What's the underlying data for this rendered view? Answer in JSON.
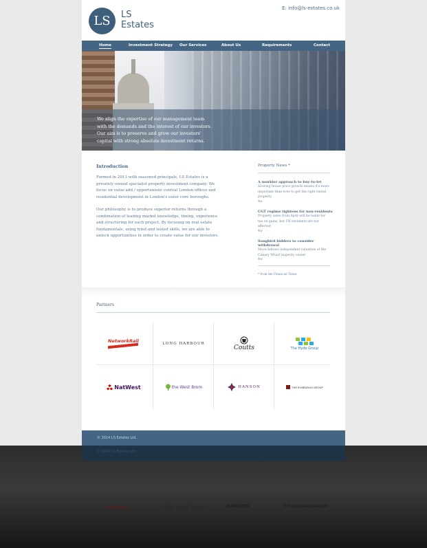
{
  "header": {
    "logo_mark": "LS",
    "logo_line1": "LS",
    "logo_line2": "Estates",
    "email": "E: info@ls-estates.co.uk"
  },
  "nav": {
    "items": [
      "Home",
      "Investment Strategy",
      "Our Services",
      "About Us",
      "Requirements",
      "Contact"
    ],
    "active": "Home"
  },
  "hero": {
    "lines": [
      "We align the expertise of our management team",
      "with the demands and the interest of our investors.",
      "Our aim is to preserve and grow our investors'",
      "capital with strong absolute investment returns."
    ]
  },
  "intro": {
    "title": "Introduction",
    "para1": [
      "Formed in 2013 with seasoned principals, LS Estates is a",
      "privately owned specialist property investment company. We",
      "focus on value add / opportunistic central London offices and",
      "residential development in London's outer core boroughs."
    ],
    "para2": [
      "Our philosophy is to produce superior returns through a",
      "combination of leading market knowledge, timing, experience",
      "and structuring for each project. By focusing on real estate",
      "fundamentals, using tried and tested skills, we are able to",
      "unlock opportunities in order to create value for our investors."
    ]
  },
  "news": {
    "title": "Property News *",
    "items": [
      {
        "title": "A murkier approach to buy-to-let",
        "text": [
          "Slowing house price growth means it's more",
          "important than ever to get the right rental",
          "property"
        ],
        "more": "4w"
      },
      {
        "title": "CGT regime tightens for non-residents",
        "text": [
          "Property sales from April will be liable for",
          "tax on gains, but UK residents are not",
          "affected"
        ],
        "more": "4w"
      },
      {
        "title": "Songbird bidders to consider withdrawal",
        "text": [
          "Move follows independent valuation of the",
          "Canary Wharf majority owner"
        ],
        "more": "4w"
      }
    ],
    "source": "* from the Financial Times"
  },
  "partners": {
    "title": "Partners",
    "logos": [
      "NetworkRail",
      "LONG HARBOUR",
      "Coutts",
      "The Hyde Group",
      "NatWest",
      "the West Brom",
      "HANSON",
      "THE ROXBURGH GROUP"
    ]
  },
  "footer": {
    "copyright": "© 2014 LS Estates Ltd."
  },
  "colors": {
    "brand": "#446684",
    "text": "#5a7690",
    "background": "#eaeaea"
  }
}
